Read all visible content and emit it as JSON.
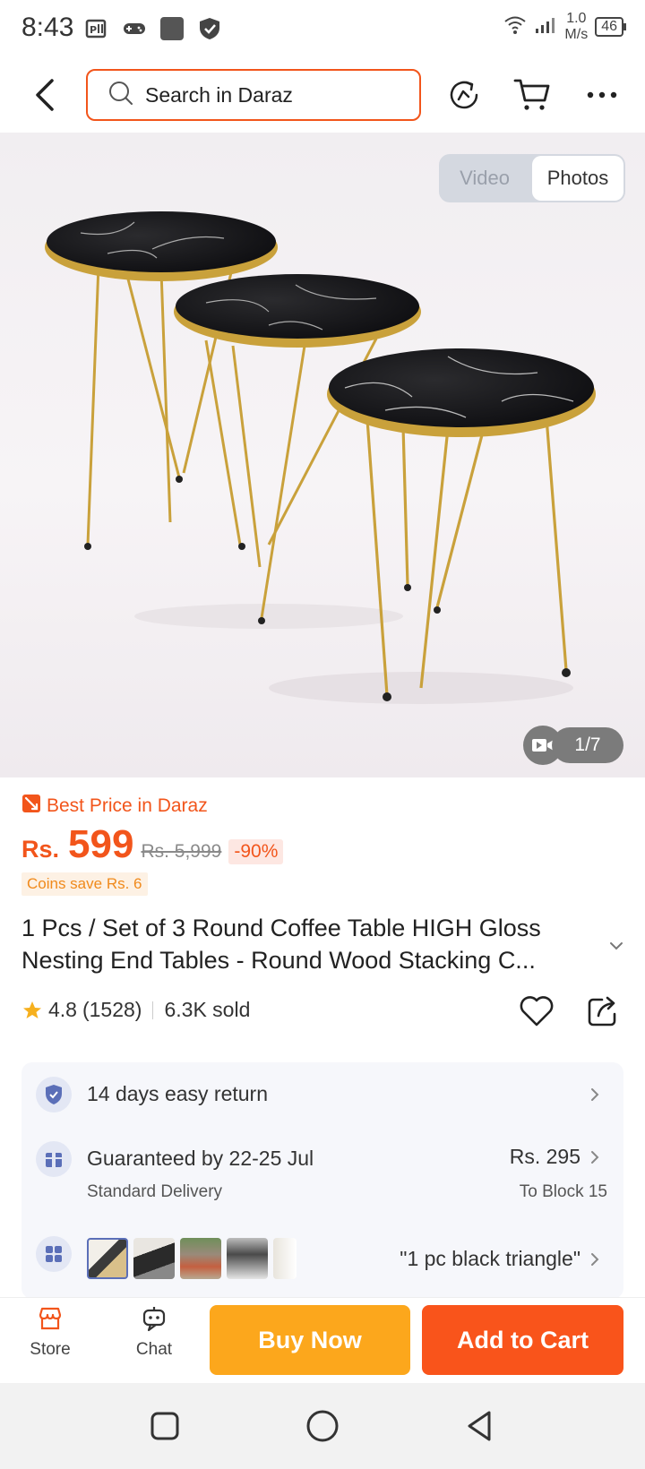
{
  "status_bar": {
    "time": "8:43",
    "net_speed_value": "1.0",
    "net_speed_unit": "M/s",
    "battery": "46"
  },
  "header": {
    "search_placeholder": "Search in Daraz"
  },
  "gallery": {
    "tab_video": "Video",
    "tab_photos": "Photos",
    "counter": "1/7"
  },
  "pricing": {
    "badge": "Best Price in Daraz",
    "currency": "Rs.",
    "price": "599",
    "original_price": "Rs. 5,999",
    "discount": "-90%",
    "coins": "Coins save Rs. 6"
  },
  "product": {
    "title": "1 Pcs / Set of 3 Round Coffee Table HIGH Gloss Nesting End Tables - Round Wood Stacking C...",
    "rating": "4.8",
    "reviews": "(1528)",
    "sold": "6.3K sold"
  },
  "info": {
    "returns": "14 days easy return",
    "delivery_title": "Guaranteed by 22-25 Jul",
    "delivery_type": "Standard Delivery",
    "delivery_fee": "Rs. 295",
    "delivery_location": "To Block 15",
    "variant_selected": "\"1 pc black triangle\""
  },
  "bottom_bar": {
    "store": "Store",
    "chat": "Chat",
    "buy_now": "Buy Now",
    "add_to_cart": "Add to Cart"
  },
  "colors": {
    "brand": "#f2551b",
    "buy_now": "#fca71c",
    "add_to_cart": "#f9541b"
  }
}
